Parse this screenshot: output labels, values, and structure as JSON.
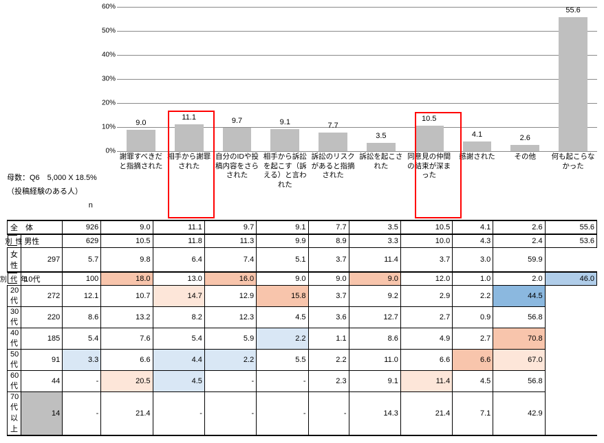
{
  "chart_data": {
    "type": "bar",
    "categories": [
      "謝罪すべきだと指摘された",
      "相手から謝罪された",
      "自分のIDや投稿内容をさらされた",
      "相手から訴訟を起こす（訴える）と言われた",
      "訴訟のリスクがあると指摘された",
      "訴訟を起こされた",
      "同意見の仲間の結束が深まった",
      "感謝された",
      "その他",
      "何も起こらなかった"
    ],
    "values": [
      9.0,
      11.1,
      9.7,
      9.1,
      7.7,
      3.5,
      10.5,
      4.1,
      2.6,
      55.6
    ],
    "ylim": [
      0,
      60
    ],
    "yticks": [
      0,
      10,
      20,
      30,
      40,
      50,
      60
    ],
    "highlighted": [
      1,
      6
    ]
  },
  "notes": {
    "line1": "母数：Q6　5,000 X 18.5%",
    "line2": "（投稿経験のある人）",
    "n_header": "n"
  },
  "group_labels": {
    "sex": "性別",
    "age": "年代別",
    "all": "全　体"
  },
  "cols": [
    "n",
    "c0",
    "c1",
    "c2",
    "c3",
    "c4",
    "c5",
    "c6",
    "c7",
    "c8",
    "c9"
  ],
  "rows": [
    {
      "label": "全　体",
      "n": "926",
      "v": [
        "9.0",
        "11.1",
        "9.7",
        "9.1",
        "7.7",
        "3.5",
        "10.5",
        "4.1",
        "2.6",
        "55.6"
      ],
      "hl": {}
    },
    {
      "label": "男性",
      "n": "629",
      "v": [
        "10.5",
        "11.8",
        "11.3",
        "9.9",
        "8.9",
        "3.3",
        "10.0",
        "4.3",
        "2.4",
        "53.6"
      ],
      "hl": {}
    },
    {
      "label": "女性",
      "n": "297",
      "v": [
        "5.7",
        "9.8",
        "6.4",
        "7.4",
        "5.1",
        "3.7",
        "11.4",
        "3.7",
        "3.0",
        "59.9"
      ],
      "hl": {}
    },
    {
      "label": "10代",
      "n": "100",
      "v": [
        "18.0",
        "13.0",
        "16.0",
        "9.0",
        "9.0",
        "9.0",
        "12.0",
        "1.0",
        "2.0",
        "46.0"
      ],
      "hl": {
        "0": "#f8c5ac",
        "2": "#f8c5ac",
        "5": "#f8c5ac",
        "9": "#b0cde9"
      }
    },
    {
      "label": "20代",
      "n": "272",
      "v": [
        "12.1",
        "10.7",
        "14.7",
        "12.9",
        "15.8",
        "3.7",
        "9.2",
        "2.9",
        "2.2",
        "44.5"
      ],
      "hl": {
        "2": "#fde6d9",
        "4": "#f8c5ac",
        "9": "#8bb8df"
      }
    },
    {
      "label": "30代",
      "n": "220",
      "v": [
        "8.6",
        "13.2",
        "8.2",
        "12.3",
        "4.5",
        "3.6",
        "12.7",
        "2.7",
        "0.9",
        "56.8"
      ],
      "hl": {}
    },
    {
      "label": "40代",
      "n": "185",
      "v": [
        "5.4",
        "7.6",
        "5.4",
        "5.9",
        "2.2",
        "1.1",
        "8.6",
        "4.9",
        "2.7",
        "70.8"
      ],
      "hl": {
        "4": "#d9e7f5",
        "9": "#f8c5ac"
      }
    },
    {
      "label": "50代",
      "n": "91",
      "v": [
        "3.3",
        "6.6",
        "4.4",
        "2.2",
        "5.5",
        "2.2",
        "11.0",
        "6.6",
        "6.6",
        "67.0"
      ],
      "hl": {
        "0": "#d9e7f5",
        "2": "#d9e7f5",
        "3": "#d9e7f5",
        "8": "#f8c5ac",
        "9": "#fde6d9"
      }
    },
    {
      "label": "60代",
      "n": "44",
      "v": [
        "-",
        "20.5",
        "4.5",
        "-",
        "-",
        "2.3",
        "9.1",
        "11.4",
        "4.5",
        "56.8"
      ],
      "hl": {
        "1": "#fde6d9",
        "2": "#d9e7f5",
        "7": "#fde6d9"
      }
    },
    {
      "label": "70代以上",
      "n": "14",
      "v": [
        "-",
        "21.4",
        "-",
        "-",
        "-",
        "-",
        "14.3",
        "21.4",
        "7.1",
        "42.9"
      ],
      "hl": {
        "n": "#bfbfbf"
      }
    }
  ]
}
